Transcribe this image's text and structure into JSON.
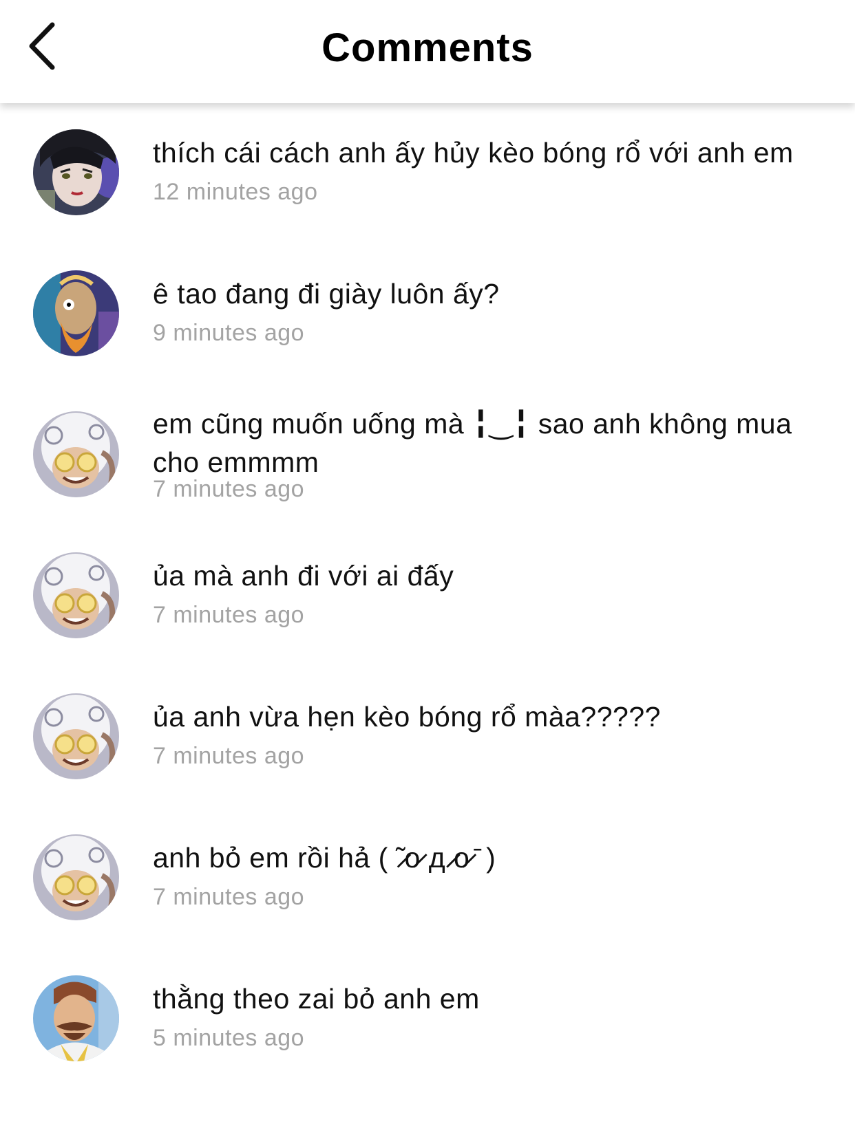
{
  "header": {
    "title": "Comments",
    "back_icon": "chevron-left-icon"
  },
  "comments": [
    {
      "avatar": "avatar-dark-hair-character",
      "text": "thích cái cách anh ấy hủy kèo bóng rổ với anh em",
      "time": "12 minutes ago"
    },
    {
      "avatar": "avatar-bearded-character",
      "text": "ê tao đang đi giày luôn ấy?",
      "time": "9 minutes ago"
    },
    {
      "avatar": "avatar-white-hair-character",
      "text": "em cũng muốn uống mà ╏‿╏ sao anh không mua cho emmmm",
      "time": "7 minutes ago"
    },
    {
      "avatar": "avatar-white-hair-character",
      "text": "ủa mà anh đi với ai đấy",
      "time": "7 minutes ago"
    },
    {
      "avatar": "avatar-white-hair-character",
      "text": "ủa anh vừa hẹn kèo bóng rổ màa?????",
      "time": "7 minutes ago"
    },
    {
      "avatar": "avatar-white-hair-character",
      "text": "anh bỏ em rồi hả ( ̃ ̷o̷ д ̷o̷ ̄ )",
      "time": "7 minutes ago"
    },
    {
      "avatar": "avatar-mustache-character",
      "text": "thằng theo zai bỏ anh em",
      "time": "5 minutes ago"
    }
  ]
}
